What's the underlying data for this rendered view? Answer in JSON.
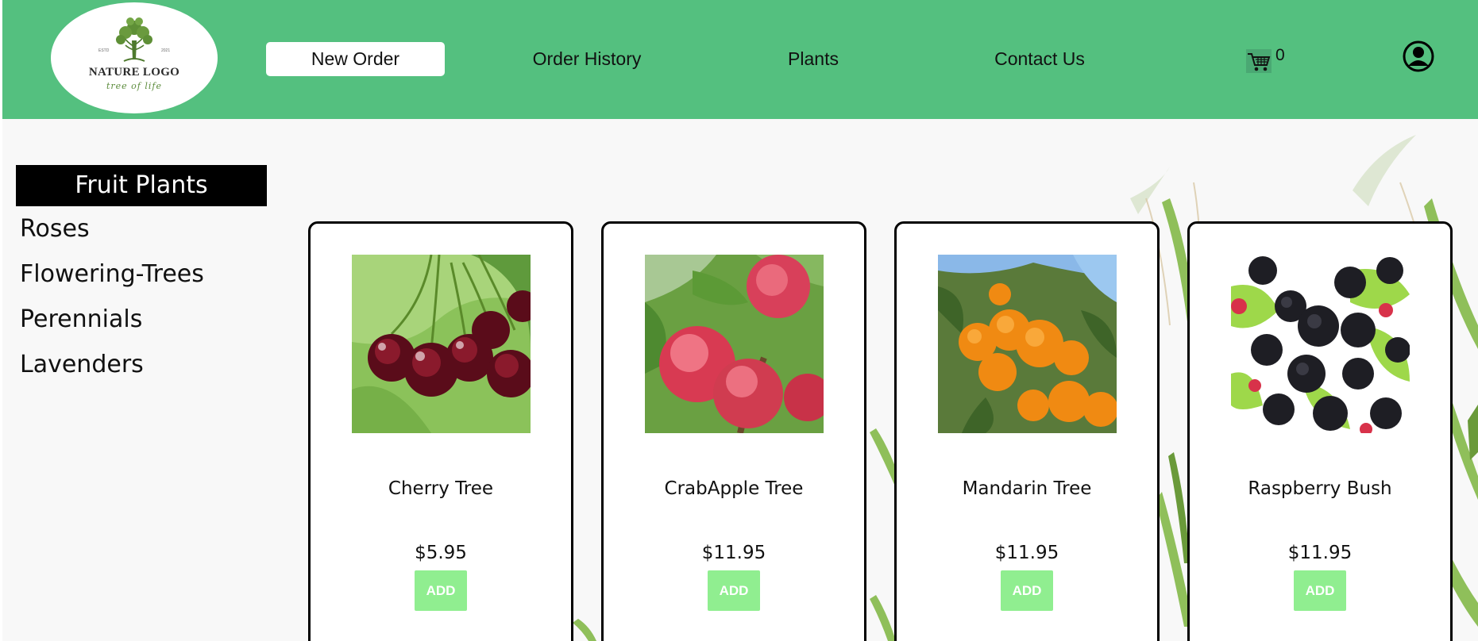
{
  "header": {
    "logo": {
      "title": "NATURE LOGO",
      "tagline": "tree of life",
      "est_left": "ESTD",
      "est_right": "2021"
    },
    "nav": [
      {
        "label": "New Order",
        "active": true
      },
      {
        "label": "Order History",
        "active": false
      },
      {
        "label": "Plants",
        "active": false
      },
      {
        "label": "Contact Us",
        "active": false
      }
    ],
    "cart": {
      "icon": "cart-icon",
      "count": "0"
    },
    "profile": {
      "icon": "user-profile-icon"
    }
  },
  "sidebar": {
    "active": "Fruit Plants",
    "items": [
      "Roses",
      "Flowering-Trees",
      "Perennials",
      "Lavenders"
    ]
  },
  "products": [
    {
      "name": "Cherry Tree",
      "price": "$5.95",
      "button": "ADD",
      "image": "cherry-image"
    },
    {
      "name": "CrabApple Tree",
      "price": "$11.95",
      "button": "ADD",
      "image": "crabapple-image"
    },
    {
      "name": "Mandarin Tree",
      "price": "$11.95",
      "button": "ADD",
      "image": "mandarin-image"
    },
    {
      "name": "Raspberry Bush",
      "price": "$11.95",
      "button": "ADD",
      "image": "raspberry-image"
    }
  ],
  "colors": {
    "header_bg": "#54c07f",
    "add_button": "#90ee90",
    "sidebar_active_bg": "#000000",
    "page_bg": "#f8f8f8"
  }
}
